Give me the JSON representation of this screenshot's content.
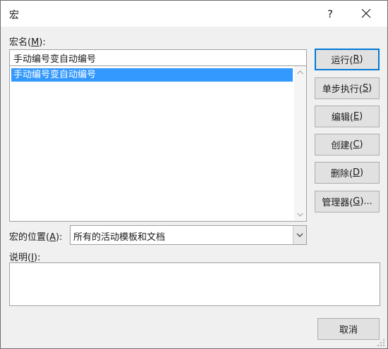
{
  "dialog": {
    "title": "宏",
    "help_label": "?"
  },
  "macro_name": {
    "label_text": "宏名(",
    "label_key": "M",
    "label_end": "):",
    "value": "手动编号变自动编号"
  },
  "macro_list": {
    "items": [
      {
        "label": "手动编号变自动编号",
        "selected": true
      }
    ]
  },
  "location": {
    "label_text": "宏的位置(",
    "label_key": "A",
    "label_end": "):",
    "value": "所有的活动模板和文档"
  },
  "description": {
    "label_text": "说明(",
    "label_key": "I",
    "label_end": "):",
    "value": ""
  },
  "buttons": {
    "run": {
      "text": "运行(",
      "key": "R",
      "end": ")"
    },
    "step": {
      "text": "单步执行(",
      "key": "S",
      "end": ")"
    },
    "edit": {
      "text": "编辑(",
      "key": "E",
      "end": ")"
    },
    "create": {
      "text": "创建(",
      "key": "C",
      "end": ")"
    },
    "delete": {
      "text": "删除(",
      "key": "D",
      "end": ")"
    },
    "organizer": {
      "text": "管理器(",
      "key": "G",
      "end": ")..."
    },
    "cancel": {
      "text": "取消"
    }
  },
  "colors": {
    "selection": "#3399ff",
    "default_button_border": "#0078d7",
    "dialog_background": "#f0f0f0"
  },
  "icons": {
    "close": "close-icon",
    "scroll_up": "chevron-up-icon",
    "scroll_down": "chevron-down-icon",
    "dropdown": "chevron-down-icon",
    "resize": "resize-grip-icon"
  }
}
